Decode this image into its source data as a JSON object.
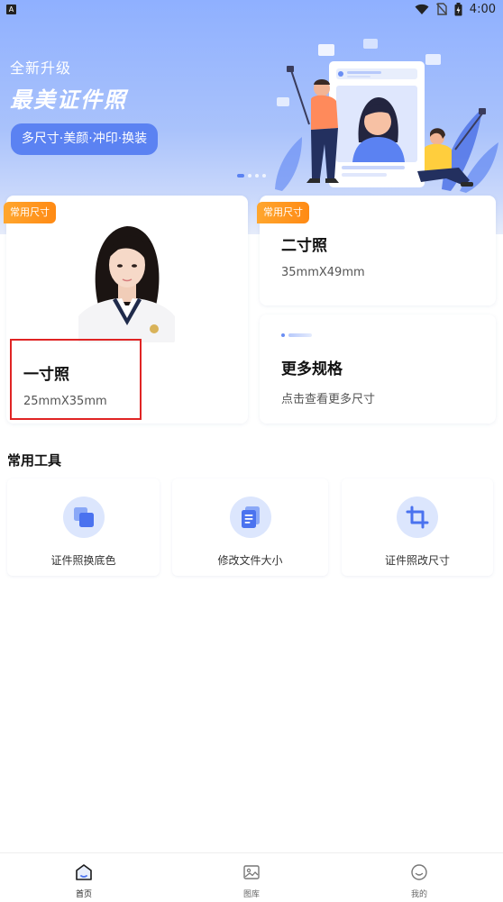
{
  "status_bar": {
    "app_chip": "A",
    "time": "4:00"
  },
  "hero": {
    "subtitle": "全新升级",
    "title": "最美证件照",
    "pill_label": "多尺寸·美颜·冲印·换装",
    "page_count": 4,
    "active_page": 1
  },
  "cards": {
    "one_inch": {
      "badge": "常用尺寸",
      "title": "一寸照",
      "size": "25mmX35mm"
    },
    "two_inch": {
      "badge": "常用尺寸",
      "title": "二寸照",
      "size": "35mmX49mm"
    },
    "more": {
      "title": "更多规格",
      "subtitle": "点击查看更多尺寸"
    }
  },
  "tools": {
    "section_title": "常用工具",
    "items": [
      {
        "label": "证件照换底色",
        "icon": "change-background-icon"
      },
      {
        "label": "修改文件大小",
        "icon": "file-size-icon"
      },
      {
        "label": "证件照改尺寸",
        "icon": "crop-icon"
      }
    ]
  },
  "bottom_nav": {
    "items": [
      {
        "label": "首页",
        "icon": "home-icon",
        "active": true
      },
      {
        "label": "图库",
        "icon": "gallery-icon",
        "active": false
      },
      {
        "label": "我的",
        "icon": "profile-icon",
        "active": false
      }
    ]
  },
  "colors": {
    "accent": "#5b82f2",
    "badge": "#ff8a14",
    "highlight": "#e02424",
    "tool_icon_bg": "#dce6fd"
  }
}
